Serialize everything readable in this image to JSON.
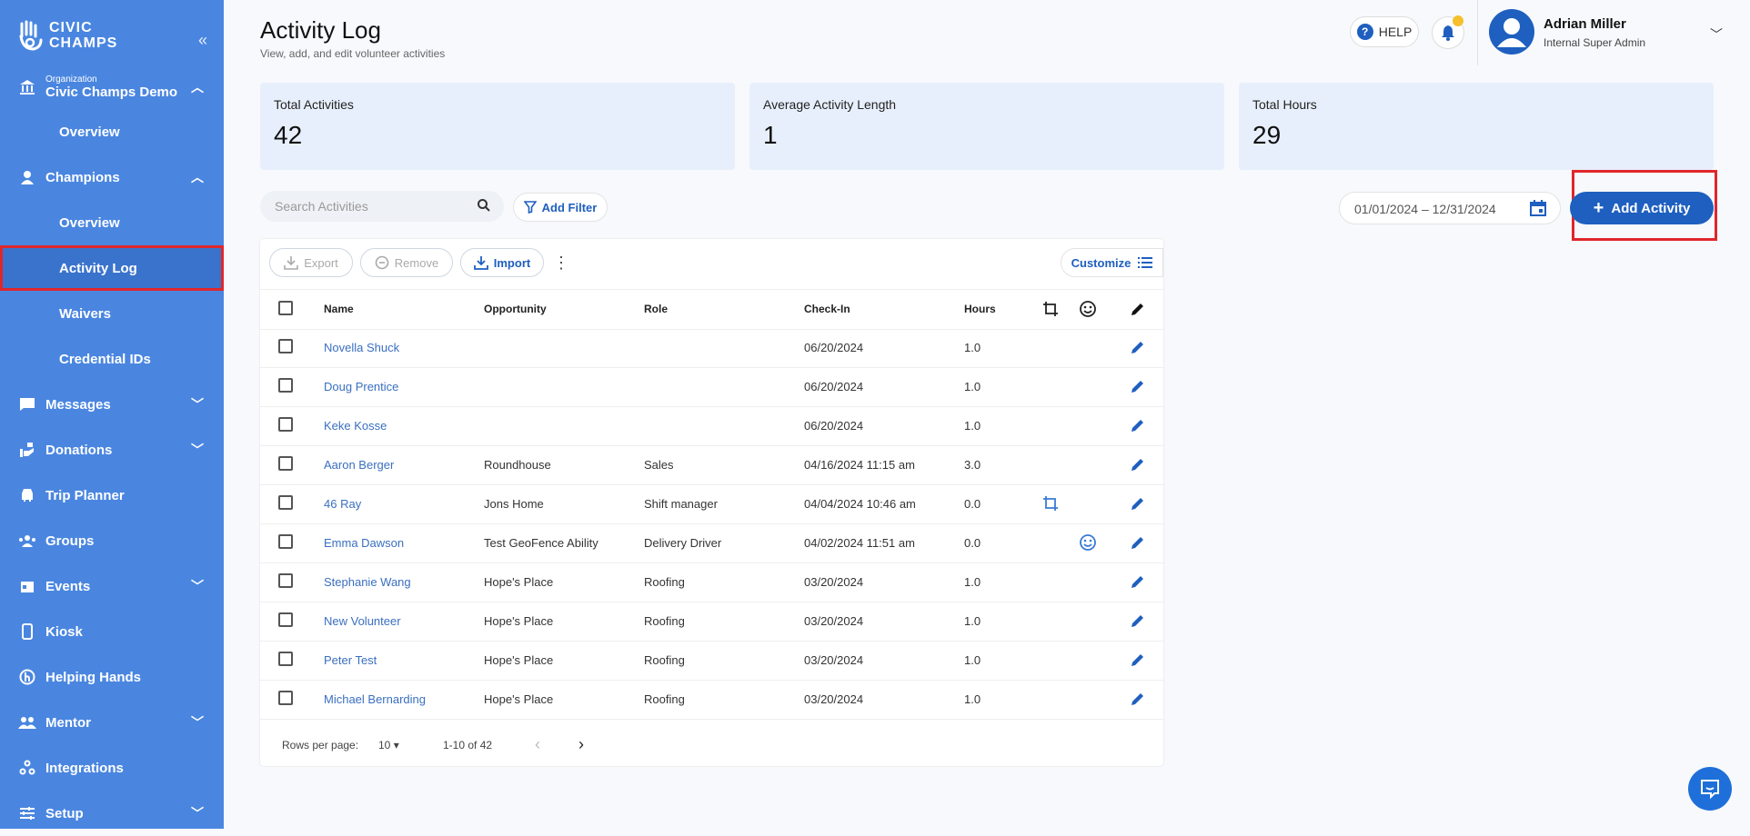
{
  "sidebar": {
    "logo_line1": "CIVIC",
    "logo_line2": "CHAMPS",
    "org_label": "Organization",
    "org_name": "Civic Champs Demo",
    "items": [
      {
        "label": "Overview",
        "sub": true
      },
      {
        "label": "Champions"
      },
      {
        "label": "Overview",
        "sub": true
      },
      {
        "label": "Activity Log",
        "sub": true,
        "active": true
      },
      {
        "label": "Waivers",
        "sub": true
      },
      {
        "label": "Credential IDs",
        "sub": true
      },
      {
        "label": "Messages"
      },
      {
        "label": "Donations"
      },
      {
        "label": "Trip Planner"
      },
      {
        "label": "Groups"
      },
      {
        "label": "Events"
      },
      {
        "label": "Kiosk"
      },
      {
        "label": "Helping Hands"
      },
      {
        "label": "Mentor"
      },
      {
        "label": "Integrations"
      },
      {
        "label": "Setup"
      }
    ]
  },
  "header": {
    "title": "Activity Log",
    "subtitle": "View, add, and edit volunteer activities",
    "help": "HELP",
    "user_name": "Adrian Miller",
    "user_role": "Internal Super Admin"
  },
  "stats": [
    {
      "label": "Total Activities",
      "value": "42"
    },
    {
      "label": "Average Activity Length",
      "value": "1"
    },
    {
      "label": "Total Hours",
      "value": "29"
    }
  ],
  "toolbar": {
    "search_placeholder": "Search Activities",
    "add_filter": "Add Filter",
    "date_range": "01/01/2024 – 12/31/2024",
    "add_activity": "Add Activity",
    "export": "Export",
    "remove": "Remove",
    "import": "Import",
    "customize": "Customize"
  },
  "table": {
    "columns": [
      "Name",
      "Opportunity",
      "Role",
      "Check-In",
      "Hours"
    ],
    "rows": [
      {
        "name": "Novella Shuck",
        "opportunity": "",
        "role": "",
        "checkin": "06/20/2024",
        "hours": "1.0"
      },
      {
        "name": "Doug Prentice",
        "opportunity": "",
        "role": "",
        "checkin": "06/20/2024",
        "hours": "1.0"
      },
      {
        "name": "Keke Kosse",
        "opportunity": "",
        "role": "",
        "checkin": "06/20/2024",
        "hours": "1.0"
      },
      {
        "name": "Aaron Berger",
        "opportunity": "Roundhouse",
        "role": "Sales",
        "checkin": "04/16/2024 11:15 am",
        "hours": "3.0"
      },
      {
        "name": "46 Ray",
        "opportunity": "Jons Home",
        "role": "Shift manager",
        "checkin": "04/04/2024 10:46 am",
        "hours": "0.0",
        "crop": true
      },
      {
        "name": "Emma Dawson",
        "opportunity": "Test GeoFence Ability",
        "role": "Delivery Driver",
        "checkin": "04/02/2024 11:51 am",
        "hours": "0.0",
        "smile": true
      },
      {
        "name": "Stephanie Wang",
        "opportunity": "Hope's Place",
        "role": "Roofing",
        "checkin": "03/20/2024",
        "hours": "1.0"
      },
      {
        "name": "New Volunteer",
        "opportunity": "Hope's Place",
        "role": "Roofing",
        "checkin": "03/20/2024",
        "hours": "1.0"
      },
      {
        "name": "Peter Test",
        "opportunity": "Hope's Place",
        "role": "Roofing",
        "checkin": "03/20/2024",
        "hours": "1.0"
      },
      {
        "name": "Michael Bernarding",
        "opportunity": "Hope's Place",
        "role": "Roofing",
        "checkin": "03/20/2024",
        "hours": "1.0"
      }
    ],
    "rows_per_page_label": "Rows per page:",
    "rows_per_page": "10",
    "range": "1-10 of 42"
  },
  "colors": {
    "sidebar": "#4a86e0",
    "primary": "#1e5fbf",
    "highlight": "#e0262b"
  }
}
